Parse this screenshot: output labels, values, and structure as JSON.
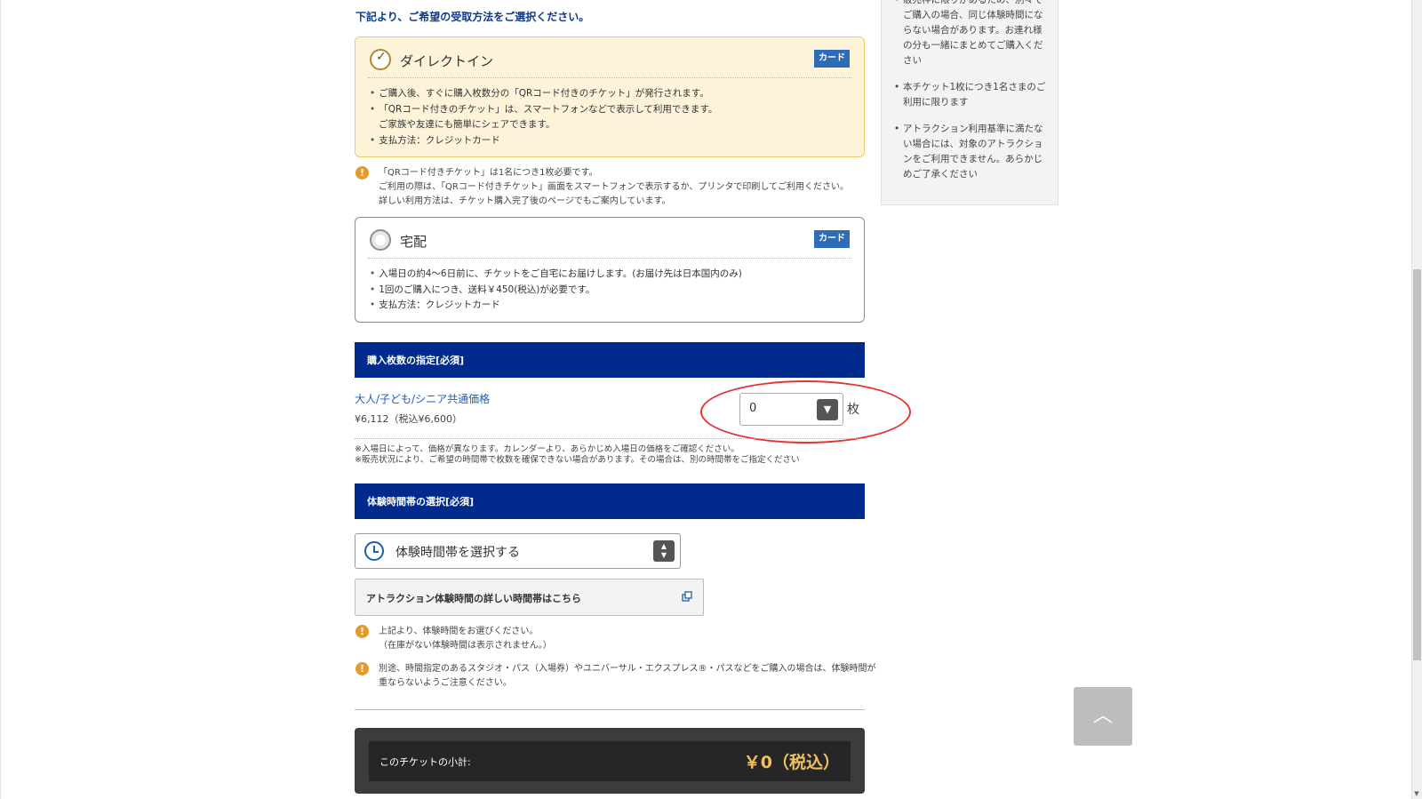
{
  "intro": {
    "text": "下記より、ご希望の受取方法をご選択ください。"
  },
  "options": {
    "direct": {
      "title": "ダイレクトイン",
      "badge": "カード",
      "lines": [
        "ご購入後、すぐに購入枚数分の「QRコード付きのチケット」が発行されます。",
        "「QRコード付きのチケット」は、スマートフォンなどで表示して利用できます。",
        "ご家族や友達にも簡単にシェアできます。",
        "支払方法：クレジットカード"
      ]
    },
    "home": {
      "title": "宅配",
      "badge": "カード",
      "lines": [
        "入場日の約4〜6日前に、チケットをご自宅にお届けします。(お届け先は日本国内のみ)",
        "1回のご購入につき、送料￥450(税込)が必要です。",
        "支払方法：クレジットカード"
      ]
    }
  },
  "qr_note": {
    "lines": [
      "「QRコード付きチケット」は1名につき1枚必要です。",
      "ご利用の際は、「QRコード付きチケット」画面をスマートフォンで表示するか、プリンタで印刷してご利用ください。",
      "詳しい利用方法は、チケット購入完了後のページでもご案内しています。"
    ]
  },
  "quantity_section": {
    "header": "購入枚数の指定[必須]",
    "ticket_name": "大人/子ども/シニア共通価格",
    "ticket_price": "¥6,112（税込¥6,600）",
    "selected_quantity": "0",
    "unit": "枚",
    "notes": [
      "※入場日によって、価格が異なります。カレンダーより、あらかじめ入場日の価格をご確認ください。",
      "※販売状況により、ご希望の時間帯で枚数を確保できない場合があります。その場合は、別の時間帯をご指定ください"
    ]
  },
  "time_section": {
    "header": "体験時間帯の選択[必須]",
    "select_placeholder": "体験時間帯を選択する",
    "detail_link": "アトラクション体験時間の詳しい時間帯はこちら",
    "notes": [
      {
        "lines": [
          "上記より、体験時間をお選びください。",
          "（在庫がない体験時間は表示されません。）"
        ]
      },
      {
        "lines": [
          "別途、時間指定のあるスタジオ・パス（入場券）やユニバーサル・エクスプレス®・パスなどをご購入の場合は、体験時間が",
          "重ならないようご注意ください。"
        ]
      }
    ]
  },
  "subtotal": {
    "label": "このチケットの小計:",
    "value": "￥0（税込）"
  },
  "sidebar": {
    "items": [
      "販売枠に限りがあるため、別々でご購入の場合、同じ体験時間にならない場合があります。お連れ様の分も一緒にまとめてご購入ください",
      "本チケット1枚につき1名さまのご利用に限ります",
      "アトラクション利用基準に満たない場合には、対象のアトラクションをご利用できません。あらかじめご了承ください"
    ]
  },
  "icons": {
    "check": "check-icon",
    "warning": "warning-icon",
    "clock": "clock-icon",
    "dropdown": "chevron-down-icon",
    "updown": "updown-icon",
    "external": "external-link-icon",
    "back_to_top": "chevron-up-icon"
  },
  "colors": {
    "section_header": "#002b8c",
    "badge": "#2d6cb6",
    "selected_card_bg": "#fcf3d9",
    "selected_card_border": "#f0c86a",
    "subtotal_value": "#f0c15e",
    "highlight_ellipse": "#e53333",
    "warning": "#e59a2a"
  }
}
